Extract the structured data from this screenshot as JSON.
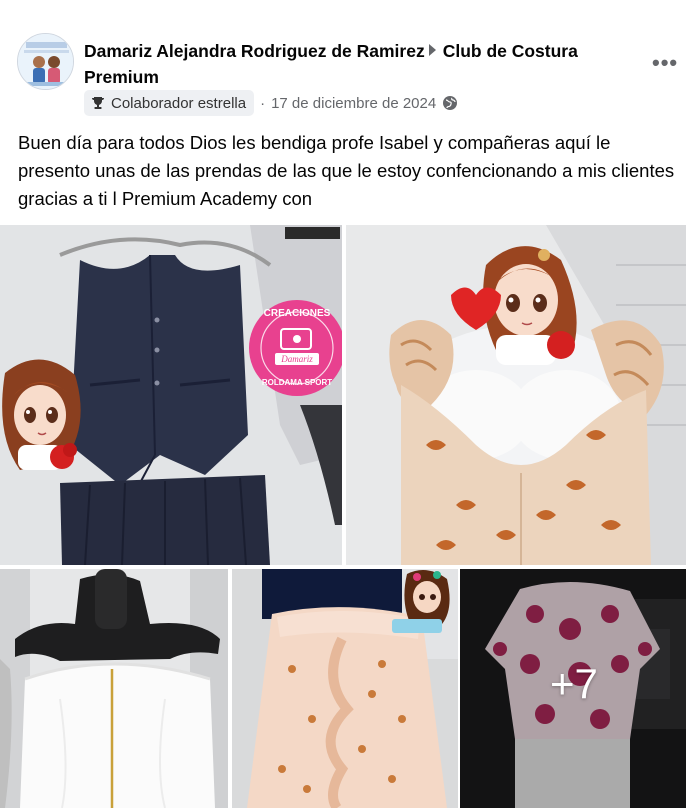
{
  "post": {
    "author": "Damariz Alejandra Rodriguez de Ramirez",
    "group": "Club de Costura Premium",
    "badge": "Colaborador estrella",
    "separator": "·",
    "date": "17 de diciembre de 2024",
    "text": "Buen día para todos Dios les bendiga profe Isabel y compañeras aquí le presento unas de las prendas de las que le estoy confencionando a mis clientes gracias a ti l Premium Academy con",
    "more_photos": "+7",
    "stamp": {
      "top": "CREACIONES",
      "bottom": "ROLDAMA SPORT",
      "name": "Damariz"
    }
  },
  "icons": {
    "more": "more-options-icon",
    "badge": "trophy-icon",
    "privacy": "globe-icon"
  },
  "colors": {
    "text_primary": "#050505",
    "text_secondary": "#65676b",
    "badge_bg": "#eef0f3",
    "stamp_pink": "#e8418f"
  }
}
